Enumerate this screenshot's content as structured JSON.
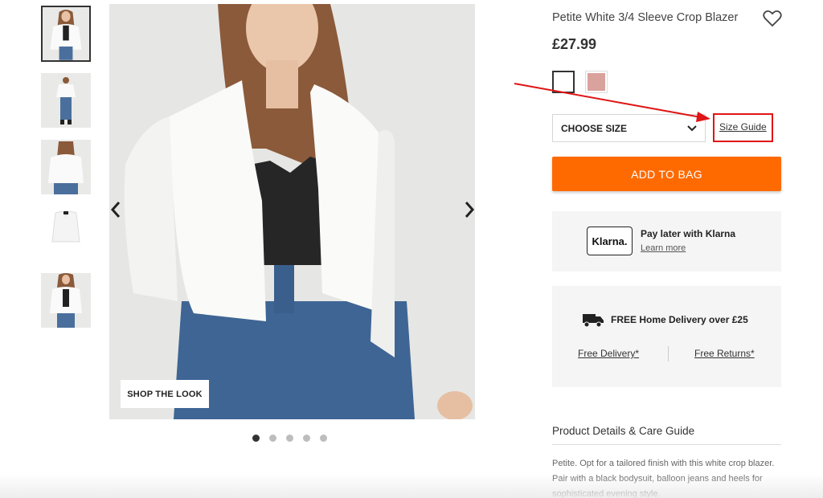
{
  "gallery": {
    "thumbnails": [
      "thumbnail-1",
      "thumbnail-2",
      "thumbnail-3",
      "thumbnail-4",
      "thumbnail-5"
    ],
    "prev_icon": "chevron-left-icon",
    "next_icon": "chevron-right-icon",
    "shop_the_look": "SHOP THE LOOK",
    "dot_count": 5,
    "active_dot": 1
  },
  "product": {
    "title": "Petite White 3/4 Sleeve Crop Blazer",
    "price": "£27.99",
    "wishlist_icon": "heart-icon",
    "swatches": [
      {
        "name": "white",
        "color": "#ffffff"
      },
      {
        "name": "pink",
        "color": "#d9a29c"
      }
    ],
    "size_select": "CHOOSE SIZE",
    "size_guide": "Size Guide",
    "add_to_bag": "ADD TO BAG"
  },
  "klarna": {
    "logo": "Klarna.",
    "title": "Pay later with Klarna",
    "link": "Learn more"
  },
  "delivery": {
    "icon": "truck-icon",
    "title": "FREE Home Delivery over £25",
    "free_delivery": "Free Delivery*",
    "free_returns": "Free Returns*"
  },
  "details": {
    "heading": "Product Details & Care Guide",
    "text": "Petite. Opt for a tailored finish with this white crop blazer. Pair with a black bodysuit, balloon jeans and heels for sophisticated evening style."
  },
  "colors": {
    "accent": "#ff6a00",
    "annotation": "#e01515"
  }
}
